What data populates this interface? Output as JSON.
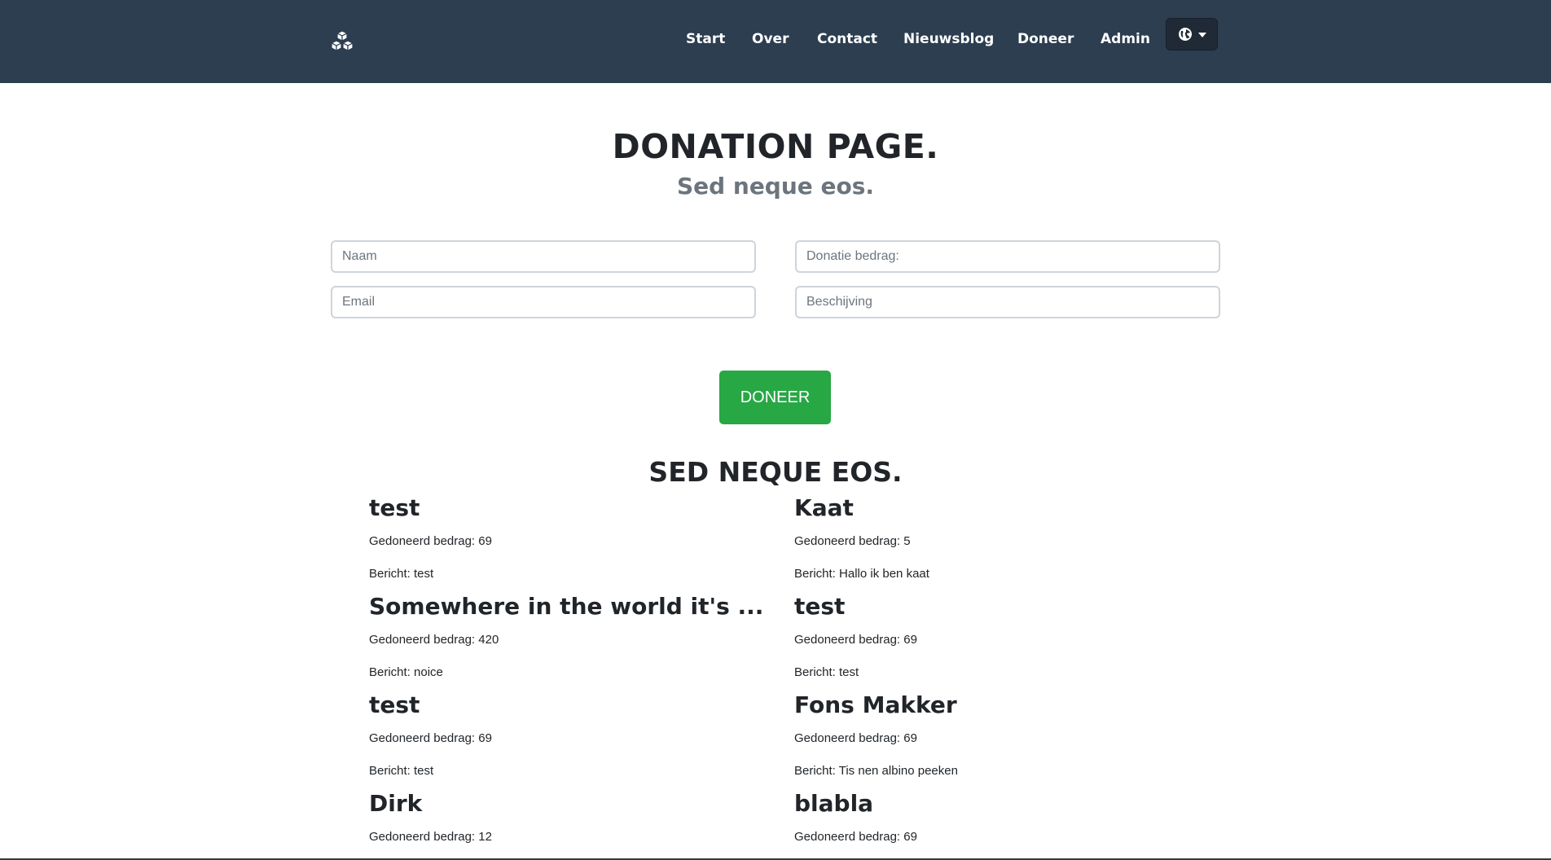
{
  "nav": {
    "logo_icon": "cubes-icon",
    "links": [
      "Start",
      "Over",
      "Contact",
      "Nieuwsblog",
      "Doneer",
      "Admin"
    ],
    "language_icon": "globe-icon"
  },
  "header": {
    "title": "DONATION PAGE.",
    "subtitle": "Sed neque eos."
  },
  "form": {
    "name_placeholder": "Naam",
    "email_placeholder": "Email",
    "amount_placeholder": "Donatie bedrag:",
    "description_placeholder": "Beschijving",
    "submit_label": "DONEER"
  },
  "donations": {
    "title": "SED NEQUE EOS.",
    "items": [
      {
        "name": "test",
        "amount": "Gedoneerd bedrag: 69",
        "message": "Bericht: test"
      },
      {
        "name": "Kaat",
        "amount": "Gedoneerd bedrag: 5",
        "message": "Bericht: Hallo ik ben kaat"
      },
      {
        "name": "Somewhere in the world it's ...",
        "amount": "Gedoneerd bedrag: 420",
        "message": "Bericht: noice"
      },
      {
        "name": "test",
        "amount": "Gedoneerd bedrag: 69",
        "message": "Bericht: test"
      },
      {
        "name": "test",
        "amount": "Gedoneerd bedrag: 69",
        "message": "Bericht: test"
      },
      {
        "name": "Fons Makker",
        "amount": "Gedoneerd bedrag: 69",
        "message": "Bericht: Tis nen albino peeken"
      },
      {
        "name": "Dirk",
        "amount": "Gedoneerd bedrag: 12",
        "message": ""
      },
      {
        "name": "blabla",
        "amount": "Gedoneerd bedrag: 69",
        "message": ""
      }
    ]
  },
  "colors": {
    "navbar": "#2c3e50",
    "button": "#28a745",
    "subtitle": "#6c757d"
  }
}
